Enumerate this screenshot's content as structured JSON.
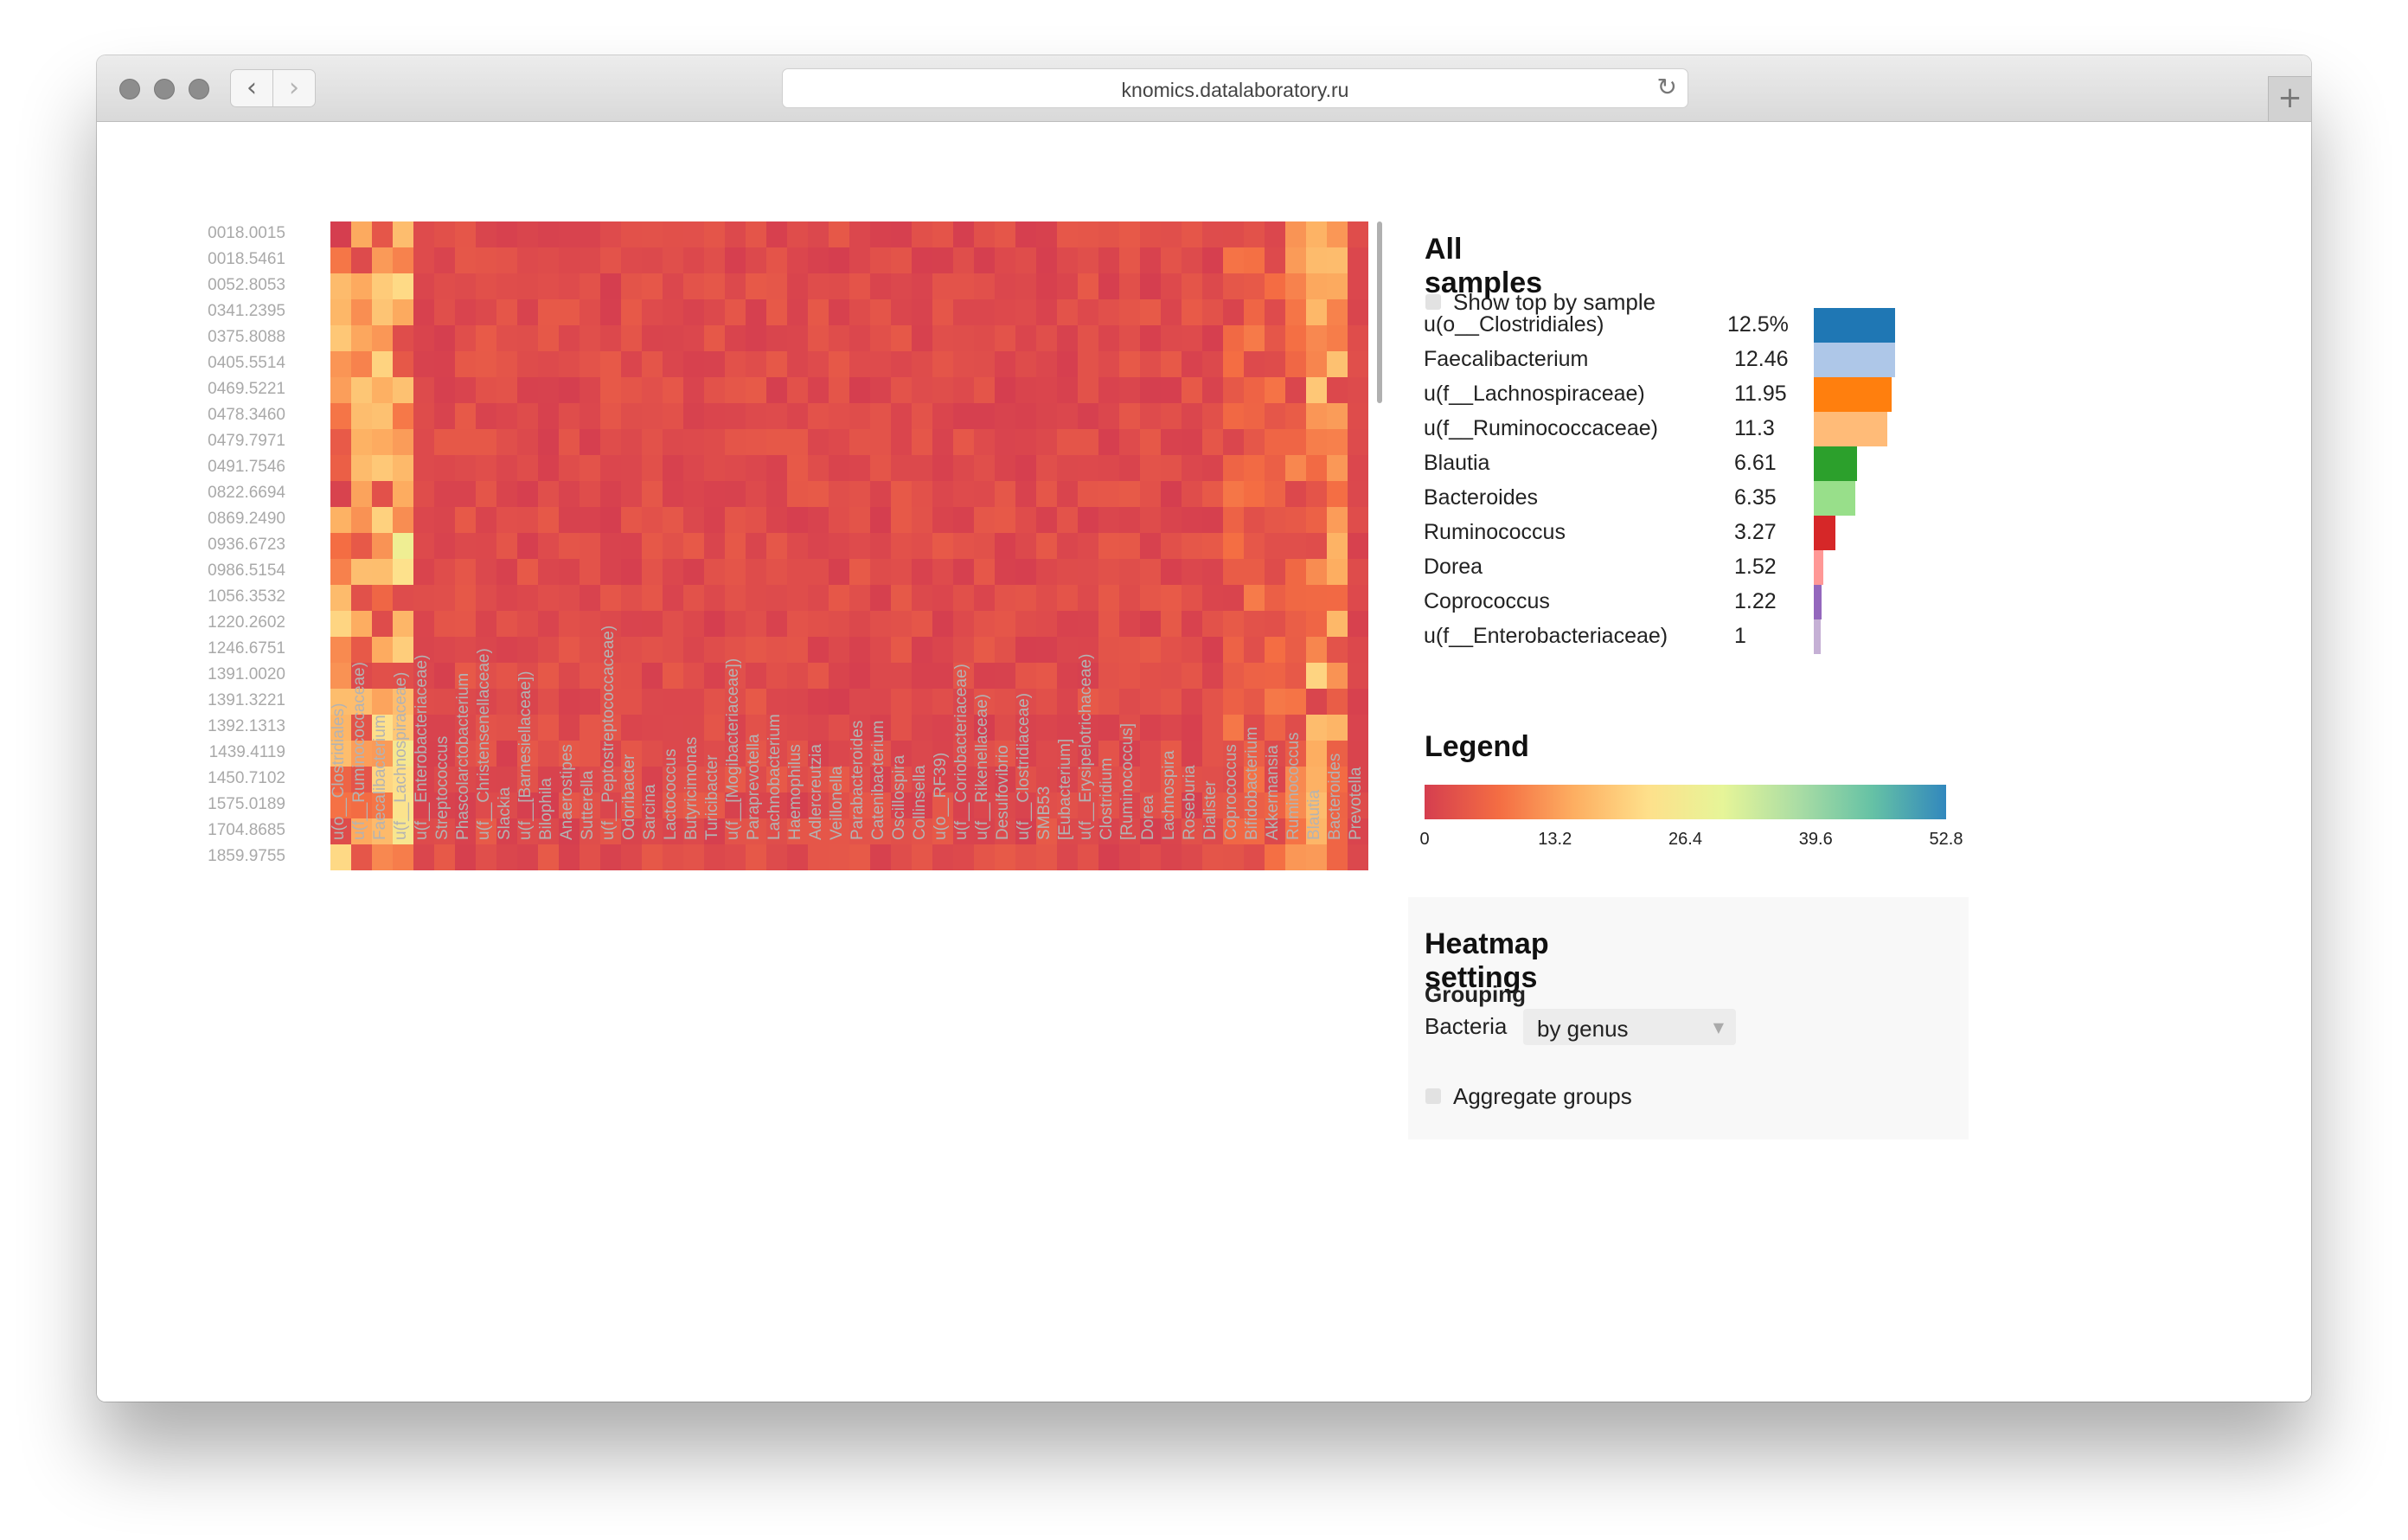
{
  "browser": {
    "url": "knomics.datalaboratory.ru",
    "back_icon": "‹",
    "forward_icon": "›",
    "reload_icon": "↻",
    "new_tab_icon": "+"
  },
  "heatmap": {
    "rows": [
      "0018.0015",
      "0018.5461",
      "0052.8053",
      "0341.2395",
      "0375.8088",
      "0405.5514",
      "0469.5221",
      "0478.3460",
      "0479.7971",
      "0491.7546",
      "0822.6694",
      "0869.2490",
      "0936.6723",
      "0986.5154",
      "1056.3532",
      "1220.2602",
      "1246.6751",
      "1391.0020",
      "1391.3221",
      "1392.1313",
      "1439.4119",
      "1450.7102",
      "1575.0189",
      "1704.8685",
      "1859.9755"
    ],
    "columns": [
      "u(o__Clostridiales)",
      "u(f__Ruminococcaceae)",
      "Faecalibacterium",
      "u(f__Lachnospiraceae)",
      "u(f__Enterobacteriaceae)",
      "Streptococcus",
      "Phascolarctobacterium",
      "u(f__Christensenellaceae)",
      "Slackia",
      "u(f__[Barnesiellaceae])",
      "Bilophila",
      "Anaerostipes",
      "Sutterella",
      "u(f__Peptostreptococcaceae)",
      "Odoribacter",
      "Sarcina",
      "Lactococcus",
      "Butyricimonas",
      "Turicibacter",
      "u(f__[Mogibacteriaceae])",
      "Paraprevotella",
      "Lachnobacterium",
      "Haemophilus",
      "Adlercreutzia",
      "Veillonella",
      "Parabacteroides",
      "Catenibacterium",
      "Oscillospira",
      "Collinsella",
      "u(o__RF39)",
      "u(f__Coriobacteriaceae)",
      "u(f__Rikenellaceae)",
      "Desulfovibrio",
      "u(f__Clostridiaceae)",
      "SMB53",
      "[Eubacterium]",
      "u(f__Erysipelotrichaceae)",
      "Clostridium",
      "[Ruminococcus]",
      "Dorea",
      "Lachnospira",
      "Roseburia",
      "Dialister",
      "Coprococcus",
      "Bifidobacterium",
      "Akkermansia",
      "Ruminococcus",
      "Blautia",
      "Bacteroides",
      "Prevotella"
    ],
    "palette": [
      "#d53e4f",
      "#f46d43",
      "#fdae61",
      "#fee08b",
      "#e6f598",
      "#abdda4",
      "#66c2a5",
      "#3288bd"
    ]
  },
  "all_samples": {
    "title": "All samples",
    "show_top_label": "Show top by sample",
    "top": [
      {
        "name": "u(o__Clostridiales)",
        "value": "12.5%",
        "num": 12.5,
        "color": "#1f77b4"
      },
      {
        "name": "Faecalibacterium",
        "value": "12.46",
        "num": 12.46,
        "color": "#aec7e8"
      },
      {
        "name": "u(f__Lachnospiraceae)",
        "value": "11.95",
        "num": 11.95,
        "color": "#ff7f0e"
      },
      {
        "name": "u(f__Ruminococcaceae)",
        "value": "11.3",
        "num": 11.3,
        "color": "#ffbb78"
      },
      {
        "name": "Blautia",
        "value": "6.61",
        "num": 6.61,
        "color": "#2ca02c"
      },
      {
        "name": "Bacteroides",
        "value": "6.35",
        "num": 6.35,
        "color": "#98df8a"
      },
      {
        "name": "Ruminococcus",
        "value": "3.27",
        "num": 3.27,
        "color": "#d62728"
      },
      {
        "name": "Dorea",
        "value": "1.52",
        "num": 1.52,
        "color": "#ff9896"
      },
      {
        "name": "Coprococcus",
        "value": "1.22",
        "num": 1.22,
        "color": "#9467bd"
      },
      {
        "name": "u(f__Enterobacteriaceae)",
        "value": "1",
        "num": 1,
        "color": "#c5b0d5"
      }
    ]
  },
  "legend": {
    "title": "Legend",
    "ticks": [
      "0",
      "13.2",
      "26.4",
      "39.6",
      "52.8"
    ]
  },
  "settings": {
    "title": "Heatmap settings",
    "grouping_label": "Grouping",
    "bacteria_label": "Bacteria",
    "bacteria_value": "by genus",
    "aggregate_label": "Aggregate groups"
  }
}
